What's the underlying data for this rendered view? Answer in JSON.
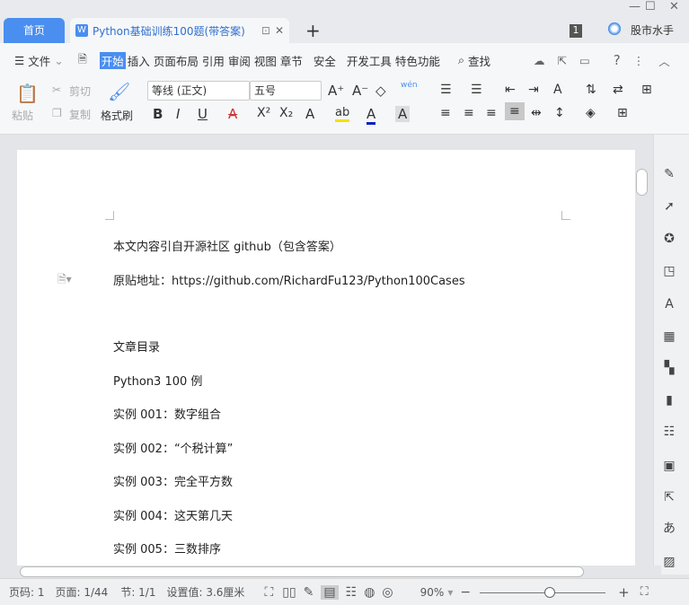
{
  "window": {
    "minimize": "—",
    "maximize": "☐",
    "close": "✕"
  },
  "tabs": {
    "home": "首页",
    "doc_title": "Python基础训练100题(带答案)",
    "new_tab": "+",
    "badge": "1",
    "user": "股市水手"
  },
  "menu": {
    "file": "文件",
    "items": [
      "开始",
      "插入",
      "页面布局",
      "引用",
      "审阅",
      "视图",
      "章节",
      "安全",
      "开发工具",
      "特色功能"
    ],
    "search": "查找",
    "help": "?"
  },
  "ribbon": {
    "paste": "粘贴",
    "cut": "剪切",
    "copy": "复制",
    "format_painter": "格式刷",
    "font": "等线 (正文)",
    "size": "五号",
    "pinyin": "wén",
    "bold": "B",
    "italic": "I",
    "underline": "U",
    "strike": "A",
    "sup": "X²",
    "sub": "X₂",
    "effect": "A",
    "highlight": "ab",
    "color": "A",
    "shade": "A"
  },
  "document": {
    "lines": [
      "本文内容引自开源社区 github（包含答案）",
      "原贴地址：https://github.com/RichardFu123/Python100Cases",
      "文章目录",
      "Python3 100 例",
      "实例 001：数字组合",
      "实例 002：“个税计算”",
      "实例 003：完全平方数",
      "实例 004：这天第几天",
      "实例 005：三数排序"
    ]
  },
  "status": {
    "page_no": "页码: 1",
    "pages": "页面: 1/44",
    "section": "节: 1/1",
    "setting": "设置值: 3.6厘米",
    "zoom": "90%",
    "zoom_level": 90
  }
}
